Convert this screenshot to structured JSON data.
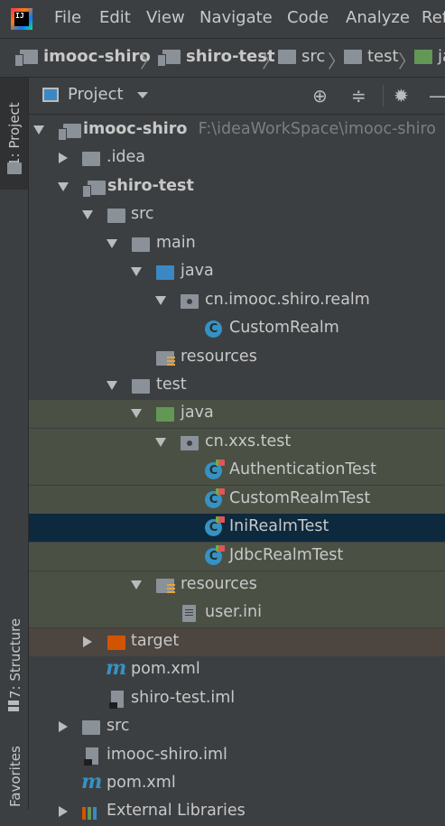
{
  "menu": {
    "items": [
      "File",
      "Edit",
      "View",
      "Navigate",
      "Code",
      "Analyze",
      "Ref"
    ]
  },
  "app_logo_text": "IJ",
  "breadcrumb": [
    {
      "label": "imooc-shiro",
      "icon": "module-folder-icon",
      "bold": true
    },
    {
      "label": "shiro-test",
      "icon": "module-folder-icon",
      "bold": true
    },
    {
      "label": "src",
      "icon": "folder-icon"
    },
    {
      "label": "test",
      "icon": "folder-icon"
    },
    {
      "label": "java",
      "icon": "test-folder-icon"
    }
  ],
  "left_strip": {
    "project_tab": "1: Project",
    "structure_tab": "7: Structure",
    "favorites_tab": "Favorites"
  },
  "panel": {
    "title": "Project",
    "icons": [
      "locate-icon",
      "collapse-all-icon",
      "settings-icon",
      "hide-icon"
    ]
  },
  "tree": {
    "root": {
      "label": "imooc-shiro",
      "path": "F:\\ideaWorkSpace\\imooc-shiro"
    },
    "idea": {
      "label": ".idea"
    },
    "shiro_test": {
      "label": "shiro-test"
    },
    "src": {
      "label": "src"
    },
    "main": {
      "label": "main"
    },
    "main_java": {
      "label": "java"
    },
    "pkg_realm": {
      "label": "cn.imooc.shiro.realm"
    },
    "custom_realm": {
      "label": "CustomRealm"
    },
    "main_resources": {
      "label": "resources"
    },
    "test": {
      "label": "test"
    },
    "test_java": {
      "label": "java"
    },
    "pkg_test": {
      "label": "cn.xxs.test"
    },
    "auth_test": {
      "label": "AuthenticationTest"
    },
    "custom_realm_test": {
      "label": "CustomRealmTest"
    },
    "ini_realm_test": {
      "label": "IniRealmTest"
    },
    "jdbc_realm_test": {
      "label": "JdbcRealmTest"
    },
    "test_resources": {
      "label": "resources"
    },
    "user_ini": {
      "label": "user.ini"
    },
    "target": {
      "label": "target"
    },
    "pom_sub": {
      "label": "pom.xml"
    },
    "iml_sub": {
      "label": "shiro-test.iml"
    },
    "src_root": {
      "label": "src"
    },
    "iml_root": {
      "label": "imooc-shiro.iml"
    },
    "pom_root": {
      "label": "pom.xml"
    },
    "ext_libs": {
      "label": "External Libraries"
    }
  },
  "class_icon_letter": "C",
  "maven_icon_letter": "m"
}
